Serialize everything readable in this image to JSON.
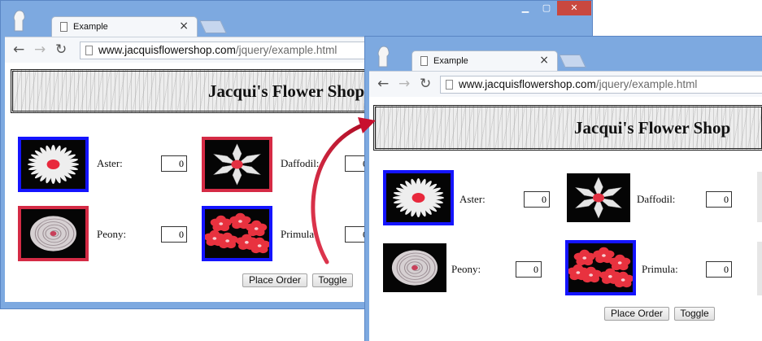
{
  "windows": {
    "before": {
      "tab_title": "Example",
      "url_host": "www.jacquisflowershop.com",
      "url_path": "/jquery/example.html",
      "shop_title": "Jacqui's Flower Shop",
      "flowers": [
        {
          "name": "Aster:",
          "qty": "0",
          "border": "#1414ff"
        },
        {
          "name": "Daffodil:",
          "qty": "0",
          "border": "#d52b45"
        },
        {
          "name": "Peony:",
          "qty": "0",
          "border": "#d52b45"
        },
        {
          "name": "Primula:",
          "qty": "0",
          "border": "#1414ff"
        }
      ],
      "place_order_label": "Place Order",
      "toggle_label": "Toggle"
    },
    "after": {
      "tab_title": "Example",
      "url_host": "www.jacquisflowershop.com",
      "url_path": "/jquery/example.html",
      "shop_title": "Jacqui's Flower Shop",
      "flowers": [
        {
          "name": "Aster:",
          "qty": "0",
          "border": "#1414ff"
        },
        {
          "name": "Daffodil:",
          "qty": "0",
          "border": "none"
        },
        {
          "name": "Peony:",
          "qty": "0",
          "border": "none"
        },
        {
          "name": "Primula:",
          "qty": "0",
          "border": "#1414ff"
        }
      ],
      "place_order_label": "Place Order",
      "toggle_label": "Toggle"
    }
  },
  "icons": {
    "minimize": "minimize-icon",
    "maximize": "maximize-icon",
    "close": "close-icon",
    "back": "back-arrow-icon",
    "forward": "forward-arrow-icon",
    "reload": "reload-icon",
    "page": "page-icon",
    "user": "user-profile-icon",
    "transition_arrow": "curved-arrow-icon"
  },
  "colors": {
    "window_frame": "#7da9e0",
    "window_close": "#c9483f",
    "selected_blue": "#1414ff",
    "selected_red": "#d52b45",
    "arrow_red": "#c8102e"
  }
}
